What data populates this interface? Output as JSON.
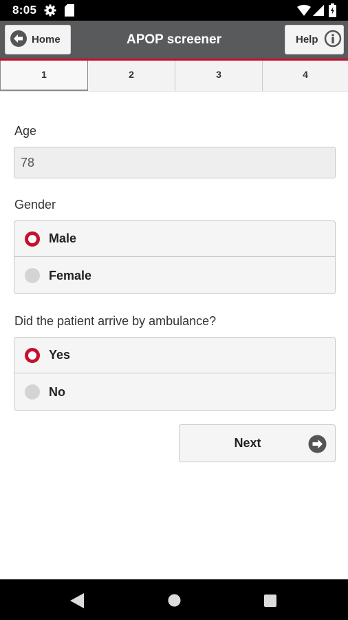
{
  "status_bar": {
    "time": "8:05",
    "icons": [
      "gear-icon",
      "sd-card-icon",
      "wifi-icon",
      "signal-icon",
      "battery-icon"
    ]
  },
  "header": {
    "home_label": "Home",
    "title": "APOP screener",
    "help_label": "Help"
  },
  "tabs": [
    {
      "label": "1",
      "active": true
    },
    {
      "label": "2",
      "active": false
    },
    {
      "label": "3",
      "active": false
    },
    {
      "label": "4",
      "active": false
    }
  ],
  "form": {
    "age": {
      "label": "Age",
      "value": "78"
    },
    "gender": {
      "label": "Gender",
      "options": [
        {
          "label": "Male",
          "selected": true
        },
        {
          "label": "Female",
          "selected": false
        }
      ]
    },
    "ambulance": {
      "label": "Did the patient arrive by ambulance?",
      "options": [
        {
          "label": "Yes",
          "selected": true
        },
        {
          "label": "No",
          "selected": false
        }
      ]
    },
    "next_label": "Next"
  },
  "colors": {
    "header_bg": "#595a5c",
    "accent": "#c8102e",
    "tab_bg": "#f3f3f3"
  },
  "nav_bar": {
    "icons": [
      "back-icon",
      "home-icon",
      "recents-icon"
    ]
  }
}
